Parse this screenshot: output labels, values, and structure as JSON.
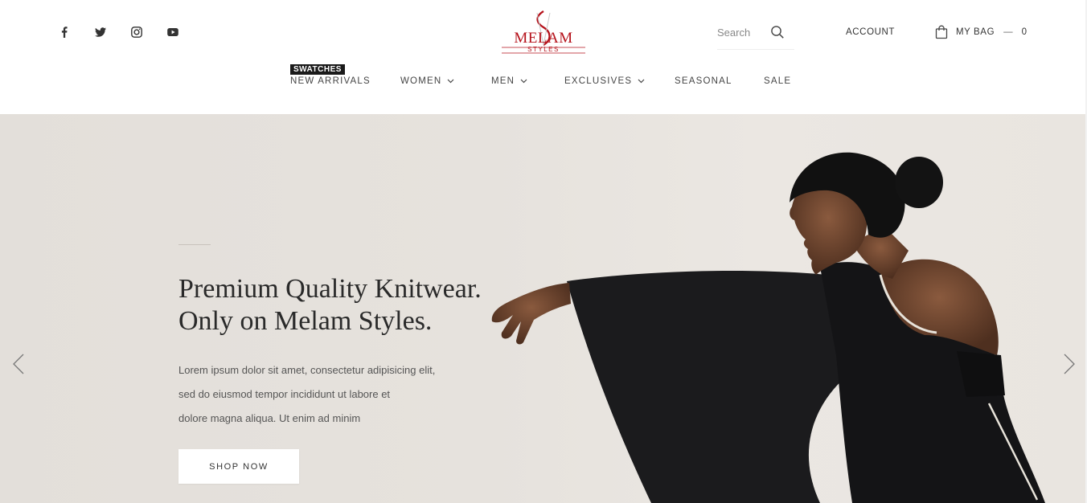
{
  "header": {
    "social": [
      {
        "name": "facebook-icon"
      },
      {
        "name": "twitter-icon"
      },
      {
        "name": "instagram-icon"
      },
      {
        "name": "youtube-icon"
      }
    ],
    "logo": {
      "letter": "S",
      "name": "MELAM",
      "tagline": "STYLES",
      "brand_color": "#b5121b"
    },
    "search": {
      "placeholder": "Search"
    },
    "account_label": "ACCOUNT",
    "bag": {
      "label": "MY BAG",
      "separator": "—",
      "count": "0"
    }
  },
  "nav": {
    "badge": "SWATCHES",
    "items": [
      {
        "label": "NEW ARRIVALS",
        "has_dropdown": false
      },
      {
        "label": "WOMEN",
        "has_dropdown": true
      },
      {
        "label": "MEN",
        "has_dropdown": true
      },
      {
        "label": "EXCLUSIVES",
        "has_dropdown": true
      },
      {
        "label": "SEASONAL",
        "has_dropdown": false
      },
      {
        "label": "SALE",
        "has_dropdown": false
      }
    ]
  },
  "hero": {
    "title_line1": "Premium Quality Knitwear.",
    "title_line2": "Only on Melam Styles.",
    "text_line1": "Lorem ipsum dolor sit amet, consectetur adipisicing elit,",
    "text_line2": "sed do eiusmod tempor incididunt ut labore et",
    "text_line3": "dolore magna aliqua. Ut enim ad minim",
    "button_label": "SHOP NOW",
    "background_color": "#e4e0db"
  }
}
